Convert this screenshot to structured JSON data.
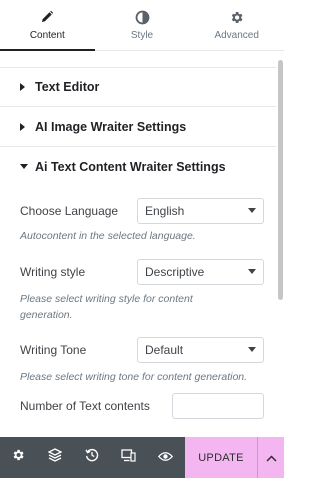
{
  "tabs": [
    {
      "label": "Content",
      "icon": "pencil-icon",
      "active": true
    },
    {
      "label": "Style",
      "icon": "half-circle-icon",
      "active": false
    },
    {
      "label": "Advanced",
      "icon": "gear-icon",
      "active": false
    }
  ],
  "sections": {
    "text_editor": "Text Editor",
    "image_settings": "AI Image Wraiter Settings",
    "text_settings": "Ai Text Content Wraiter Settings"
  },
  "controls": {
    "language": {
      "label": "Choose Language",
      "value": "English",
      "desc": "Autocontent in the selected language."
    },
    "style": {
      "label": "Writing style",
      "value": "Descriptive",
      "desc": "Please select writing style for content generation."
    },
    "tone": {
      "label": "Writing Tone",
      "value": "Default",
      "desc": "Please select writing tone for content generation."
    },
    "count": {
      "label": "Number of Text contents"
    }
  },
  "footer": {
    "update_label": "UPDATE",
    "icons": [
      "gear-icon",
      "layers-icon",
      "history-icon",
      "responsive-icon",
      "eye-icon"
    ]
  },
  "colors": {
    "footer_bg": "#495157",
    "update_bg": "#f4b6f0",
    "active_tab": "#1f2124"
  }
}
